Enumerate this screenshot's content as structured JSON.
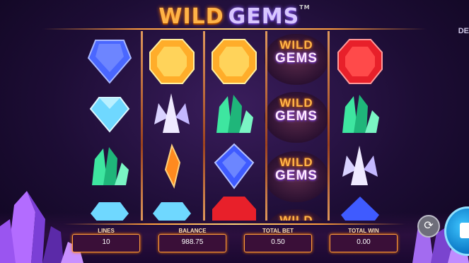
{
  "logo": {
    "word1": "WILD",
    "word2": "GEMS",
    "tm": "TM"
  },
  "corner_text": "DE",
  "wild_symbol": {
    "line1": "WILD",
    "line2": "GEMS"
  },
  "reels": [
    [
      "gem-blue-sapphire",
      "gem-diamond",
      "gem-green-crystal",
      "gem-diamond"
    ],
    [
      "gem-orange-topaz",
      "gem-white-crystal",
      "gem-orange-shard",
      "gem-diamond"
    ],
    [
      "gem-orange-topaz",
      "gem-green-crystal",
      "gem-blue-sapphire",
      "gem-red-ruby"
    ],
    [
      "wild",
      "wild",
      "wild",
      "wild"
    ],
    [
      "gem-red-ruby",
      "gem-green-crystal",
      "gem-white-crystal",
      "gem-blue-sapphire"
    ]
  ],
  "stats": {
    "lines": {
      "label": "LINES",
      "value": "10"
    },
    "balance": {
      "label": "BALANCE",
      "value": "988.75"
    },
    "total_bet": {
      "label": "TOTAL BET",
      "value": "0.50"
    },
    "total_win": {
      "label": "TOTAL WIN",
      "value": "0.00"
    }
  },
  "buttons": {
    "autoplay_icon": "refresh-icon",
    "spin_icon": "stop-icon"
  },
  "colors": {
    "accent": "#ff9d3d",
    "panel_bg": "#3a0f38",
    "background": "#1d0d35"
  }
}
